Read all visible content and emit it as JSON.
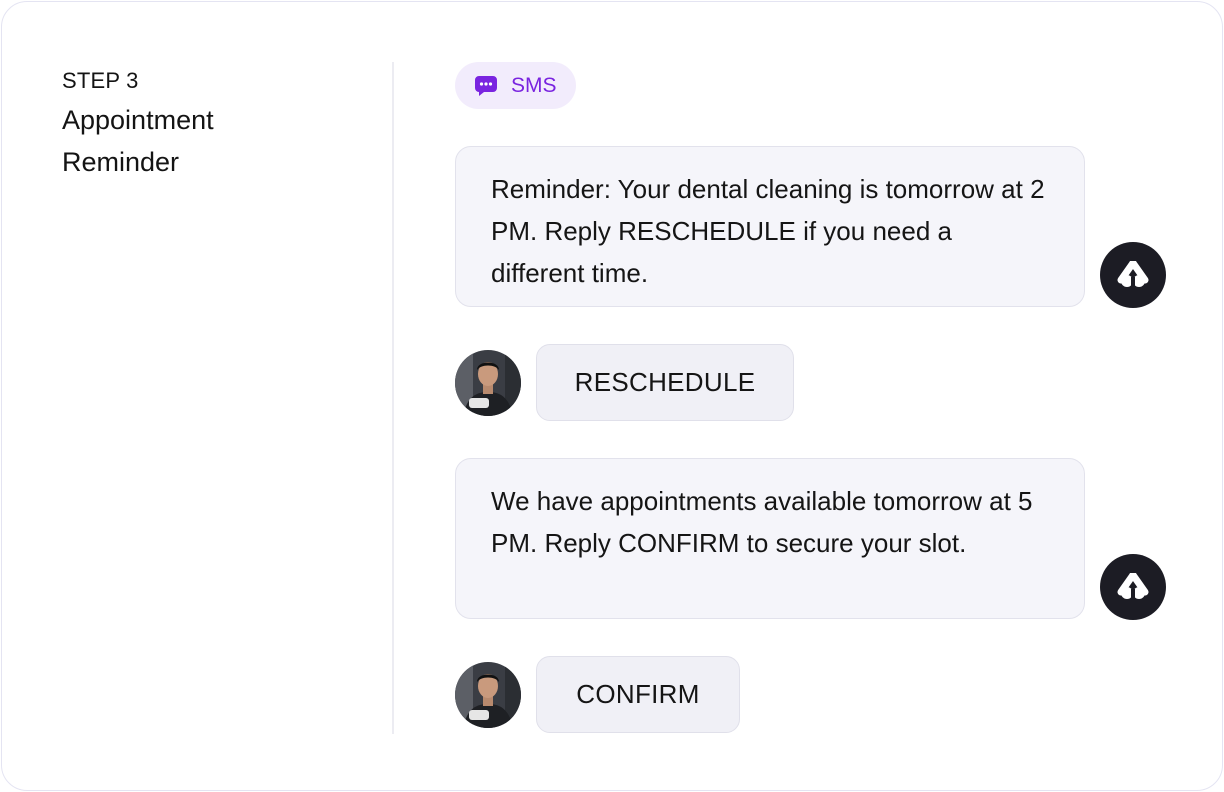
{
  "step": {
    "label": "STEP 3",
    "title": "Appointment Reminder"
  },
  "channel": {
    "icon": "chat-bubble-icon",
    "label": "SMS",
    "color": "#7a24e0",
    "background": "#f2ecfc"
  },
  "messages": [
    {
      "sender": "bot",
      "avatar": "assistant-logo-icon",
      "text": "Reminder: Your dental cleaning is tomorrow at 2 PM. Reply RESCHEDULE if you need a different time."
    },
    {
      "sender": "user",
      "avatar": "user-photo",
      "text": "RESCHEDULE"
    },
    {
      "sender": "bot",
      "avatar": "assistant-logo-icon",
      "text": "We have appointments available tomorrow at 5 PM. Reply CONFIRM to secure your slot."
    },
    {
      "sender": "user",
      "avatar": "user-photo",
      "text": "CONFIRM"
    }
  ]
}
